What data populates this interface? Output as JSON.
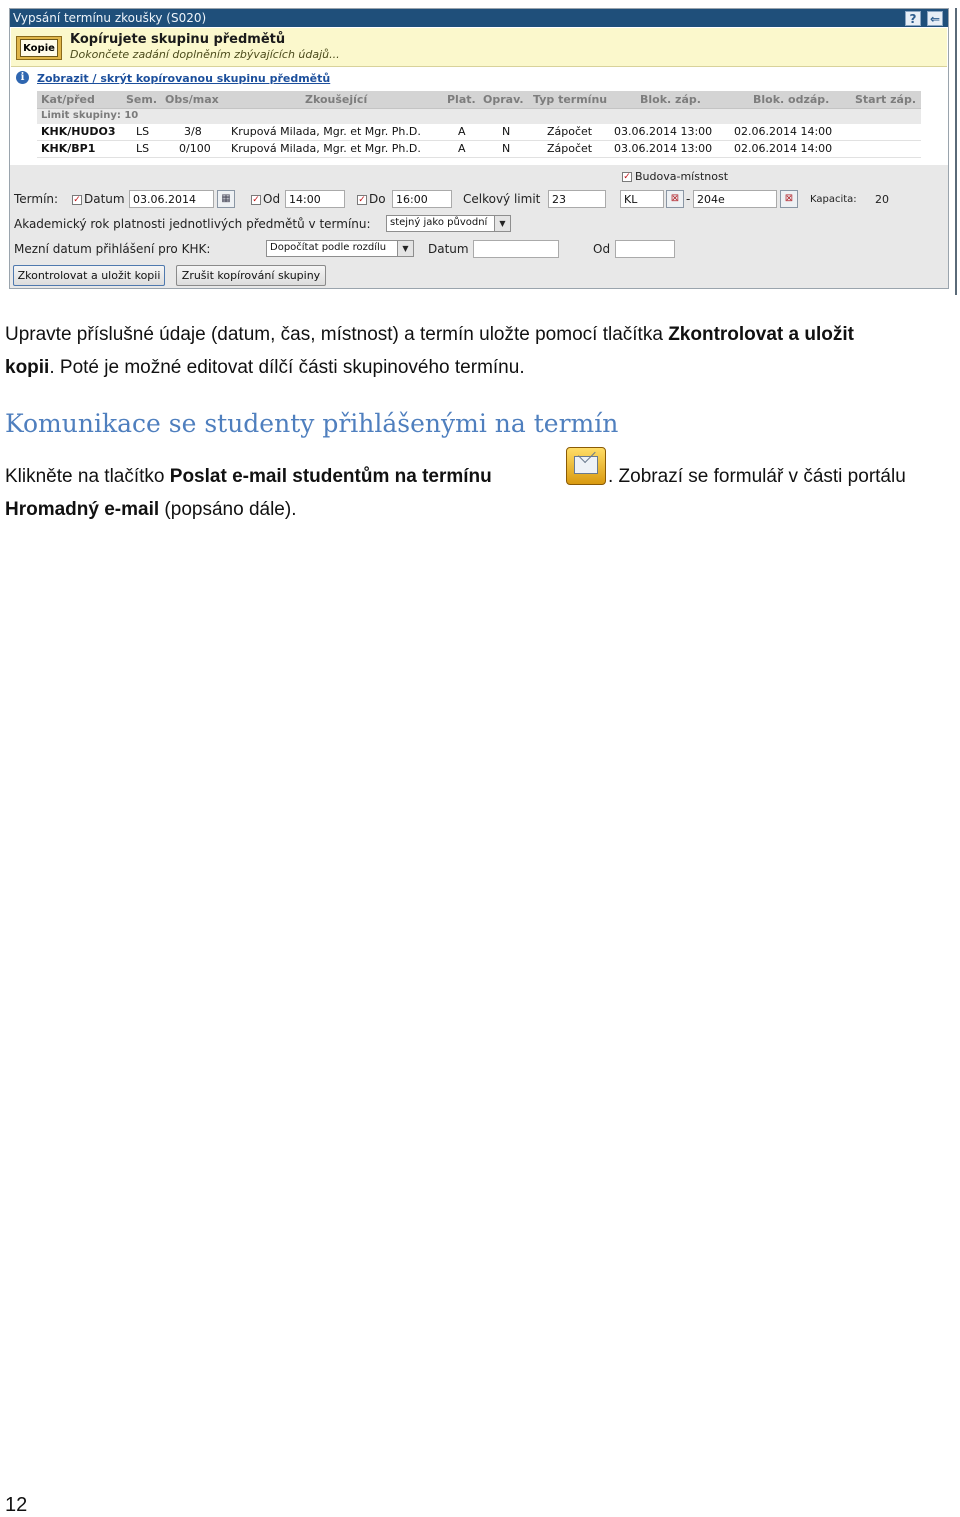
{
  "window": {
    "title": "Vypsání termínu zkoušky (S020)",
    "help_label": "?",
    "back_label": "⇐"
  },
  "banner": {
    "icon_text": "Kopie",
    "icon_letter": "T",
    "title": "Kopírujete skupinu předmětů",
    "subtitle": "Dokončete zadání doplněním zbývajících údajů..."
  },
  "toggle": {
    "info_glyph": "i",
    "label": "Zobrazit / skrýt kopírovanou skupinu předmětů"
  },
  "table": {
    "headers": [
      "Kat/před",
      "Sem.",
      "Obs/max",
      "Zkoušející",
      "Plat.",
      "Oprav.",
      "Typ termínu",
      "Blok. záp.",
      "Blok. odzáp.",
      "Start záp."
    ],
    "limit": "Limit skupiny: 10",
    "rows": [
      [
        "KHK/HUDO3",
        "LS",
        "3/8",
        "Krupová Milada, Mgr. et Mgr. Ph.D.",
        "A",
        "N",
        "Zápočet",
        "03.06.2014 13:00",
        "02.06.2014 14:00",
        ""
      ],
      [
        "KHK/BP1",
        "LS",
        "0/100",
        "Krupová Milada, Mgr. et Mgr. Ph.D.",
        "A",
        "N",
        "Zápočet",
        "03.06.2014 13:00",
        "02.06.2014 14:00",
        ""
      ]
    ]
  },
  "form": {
    "building_room_label": "Budova-místnost",
    "termin_label": "Termín:",
    "datum_label": "Datum",
    "datum_value": "03.06.2014",
    "od_label": "Od",
    "od_value": "14:00",
    "do_label": "Do",
    "do_value": "16:00",
    "celkovy_limit_label": "Celkový limit",
    "celkovy_limit_value": "23",
    "building_value": "KL",
    "room_value": "204e",
    "kapacita_label": "Kapacita:",
    "kapacita_value": "20",
    "akad_rok_label": "Akademický rok platnosti jednotlivých předmětů v termínu:",
    "akad_rok_value": "stejný jako původní",
    "mezni_label": "Mezní datum přihlášení pro KHK:",
    "mezni_value": "Dopočítat podle rozdílu",
    "datum2_label": "Datum",
    "datum2_value": "",
    "od2_label": "Od",
    "od2_value": "",
    "save_button": "Zkontrolovat a uložit kopii",
    "cancel_button": "Zrušit kopírování skupiny"
  },
  "doc": {
    "p1_text": "Upravte příslušné údaje (datum, čas, místnost) a termín uložte pomocí tlačítka",
    "p1_bold": "Zkontrolovat a uložit",
    "p1_line2_bold": "kopii",
    "p1_line2_text": ". Poté je možné editovat dílčí části skupinového termínu.",
    "heading": "Komunikace se studenty přihlášenými na termín",
    "p2_text_a": "Klikněte na tlačítko",
    "p2_bold": "Poslat e-mail studentům na termínu",
    "p2_text_b": ". Zobrazí se formulář v části portálu",
    "p2_line2_bold": "Hromadný e-mail",
    "p2_line2_text": " (popsáno dále).",
    "page_number": "12"
  }
}
